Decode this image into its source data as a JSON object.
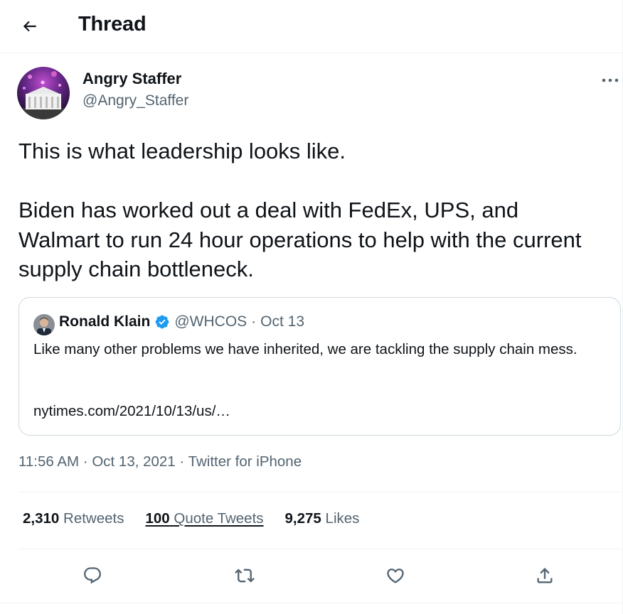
{
  "header": {
    "title": "Thread"
  },
  "tweet": {
    "author_name": "Angry Staffer",
    "author_handle": "@Angry_Staffer",
    "text": "This is what leadership looks like.\n\nBiden has worked out a deal with FedEx, UPS, and Walmart to run 24 hour operations to help with the current supply chain bottleneck.",
    "time": "11:56 AM",
    "date": "Oct 13, 2021",
    "source": "Twitter for iPhone",
    "dot": "·"
  },
  "quote": {
    "name": "Ronald Klain",
    "handle": "@WHCOS",
    "date": "Oct 13",
    "dot": "·",
    "text": "Like many other problems we have inherited, we are tackling the supply chain mess.",
    "link": "nytimes.com/2021/10/13/us/…"
  },
  "stats": {
    "retweets_count": "2,310",
    "retweets_label": "Retweets",
    "quotes_count": "100",
    "quotes_label": "Quote Tweets",
    "likes_count": "9,275",
    "likes_label": "Likes"
  },
  "icons": {
    "back": "arrow-left-icon",
    "more": "more-dots-icon",
    "verified": "verified-badge-icon",
    "reply": "reply-icon",
    "retweet": "retweet-icon",
    "like": "heart-icon",
    "share": "share-icon"
  },
  "colors": {
    "text": "#0f1419",
    "secondary": "#536471",
    "border": "#cfd9de",
    "verified": "#1d9bf0"
  }
}
